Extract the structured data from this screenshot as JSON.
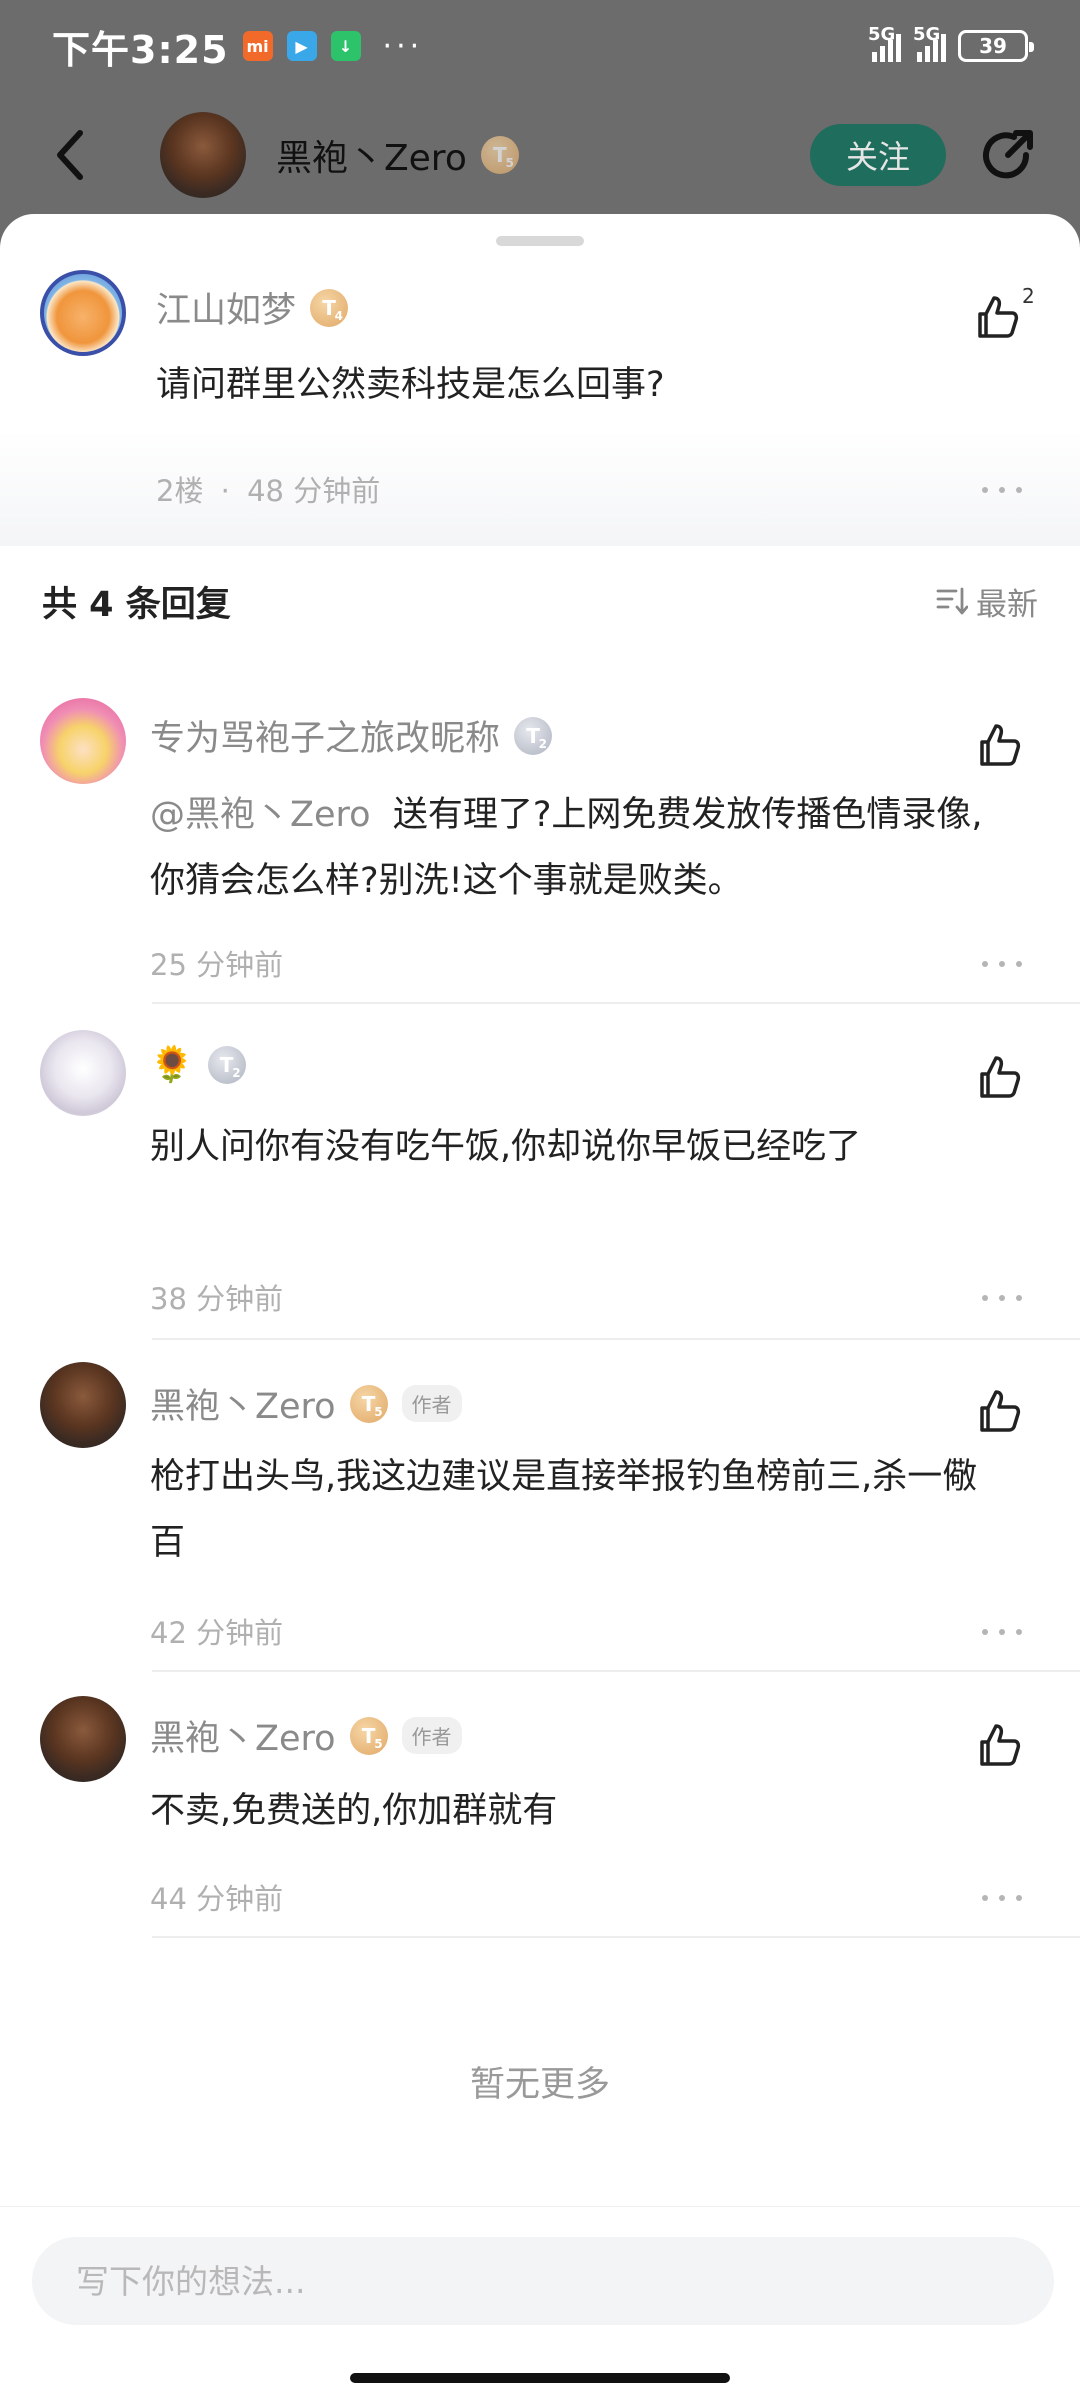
{
  "status_bar": {
    "time": "下午3:25",
    "more": "···",
    "signal_1": "5G",
    "signal_2": "5G",
    "battery": "39"
  },
  "header": {
    "name": "黑袍丶Zero",
    "level": "5",
    "follow_label": "关注"
  },
  "main_comment": {
    "username": "江山如梦",
    "level": "4",
    "text": "请问群里公然卖科技是怎么回事?",
    "floor": "2楼",
    "separator": "·",
    "time": "48 分钟前",
    "like_count": "2"
  },
  "replies_header": {
    "title": "共 4 条回复",
    "sort_label": "最新"
  },
  "replies": [
    {
      "username": "专为骂袍子之旅改昵称",
      "level": "2",
      "mention": "@黑袍丶Zero",
      "text": "送有理了?上网免费发放传播色情录像,你猜会怎么样?别洗!这个事就是败类。",
      "time": "25 分钟前"
    },
    {
      "username": "🌻",
      "level": "2",
      "text": "别人问你有没有吃午饭,你却说你早饭已经吃了",
      "time": "38 分钟前"
    },
    {
      "username": "黑袍丶Zero",
      "level": "5",
      "author_tag": "作者",
      "text": "枪打出头鸟,我这边建议是直接举报钓鱼榜前三,杀一儆百",
      "time": "42 分钟前"
    },
    {
      "username": "黑袍丶Zero",
      "level": "5",
      "author_tag": "作者",
      "text": "不卖,免费送的,你加群就有",
      "time": "44 分钟前"
    }
  ],
  "no_more": "暂无更多",
  "input": {
    "placeholder": "写下你的想法..."
  },
  "colors": {
    "follow_bg": "#1f6d5c",
    "overlay": "#6c6c6c",
    "gold_badge": "#e0a866",
    "silver_badge": "#aeb3bf"
  }
}
